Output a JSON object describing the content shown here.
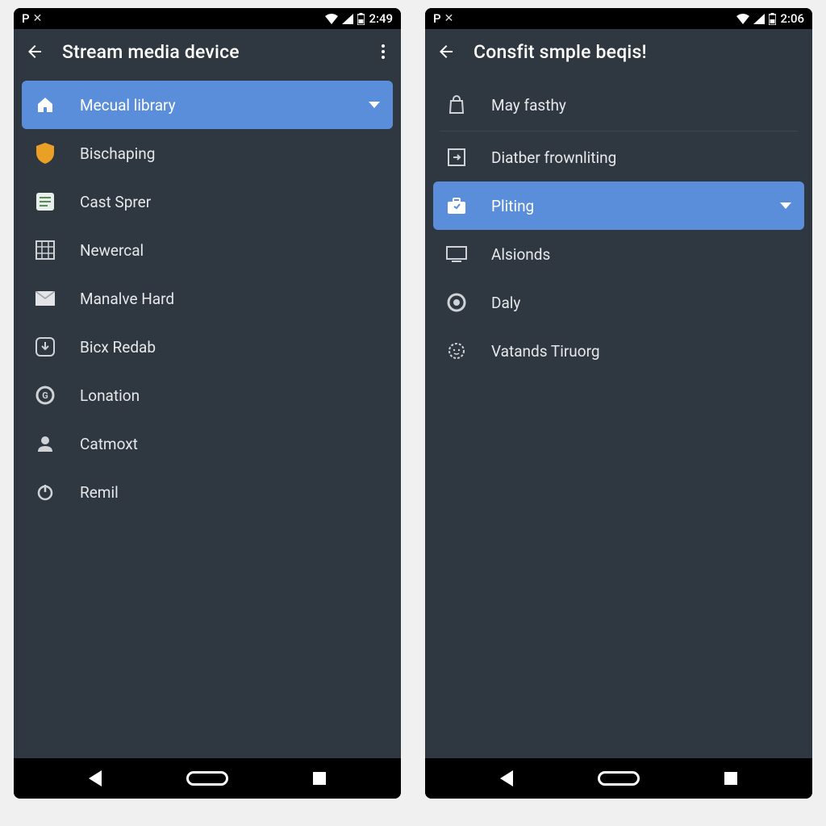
{
  "left": {
    "status": {
      "p_label": "P",
      "close": "✕",
      "time": "2:49"
    },
    "appbar": {
      "title": "Stream media device"
    },
    "items": [
      {
        "label": "Mecual library",
        "selected": true,
        "dropdown": true,
        "icon": "home"
      },
      {
        "label": "Bischaping",
        "icon": "shield"
      },
      {
        "label": "Cast Sprer",
        "icon": "note"
      },
      {
        "label": "Newercal",
        "icon": "grid"
      },
      {
        "label": "Manalve Hard",
        "icon": "mail"
      },
      {
        "label": "Bicx Redab",
        "icon": "download"
      },
      {
        "label": "Lonation",
        "icon": "circle-g"
      },
      {
        "label": "Catmoxt",
        "icon": "person"
      },
      {
        "label": "Remil",
        "icon": "power"
      }
    ]
  },
  "right": {
    "status": {
      "p_label": "P",
      "close": "✕",
      "time": "2:06"
    },
    "appbar": {
      "title": "Consfit smple beqis!"
    },
    "items": [
      {
        "label": "May fasthy",
        "icon": "bag",
        "divider_after": true
      },
      {
        "label": "Diatber frownliting",
        "icon": "box-arrow"
      },
      {
        "label": "Pliting",
        "icon": "briefcase",
        "selected": true,
        "dropdown": true
      },
      {
        "label": "Alsionds",
        "icon": "monitor"
      },
      {
        "label": "Daly",
        "icon": "disc"
      },
      {
        "label": "Vatands Tiruorg",
        "icon": "face"
      }
    ]
  }
}
